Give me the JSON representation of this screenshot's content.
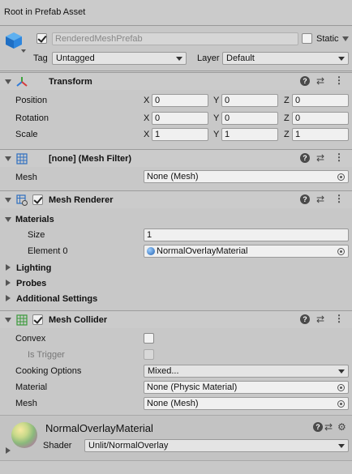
{
  "header": {
    "title": "Root in Prefab Asset"
  },
  "gameobject": {
    "name": "RenderedMeshPrefab",
    "static_label": "Static",
    "tag_label": "Tag",
    "tag_value": "Untagged",
    "layer_label": "Layer",
    "layer_value": "Default"
  },
  "transform": {
    "title": "Transform",
    "rows": [
      {
        "label": "Position",
        "x": "0",
        "y": "0",
        "z": "0"
      },
      {
        "label": "Rotation",
        "x": "0",
        "y": "0",
        "z": "0"
      },
      {
        "label": "Scale",
        "x": "1",
        "y": "1",
        "z": "1"
      }
    ],
    "x": "X",
    "y": "Y",
    "z": "Z"
  },
  "mesh_filter": {
    "title": "[none] (Mesh Filter)",
    "mesh_label": "Mesh",
    "mesh_value": "None (Mesh)"
  },
  "mesh_renderer": {
    "title": "Mesh Renderer",
    "materials_label": "Materials",
    "size_label": "Size",
    "size_value": "1",
    "element0_label": "Element 0",
    "element0_value": "NormalOverlayMaterial",
    "lighting": "Lighting",
    "probes": "Probes",
    "additional": "Additional Settings"
  },
  "mesh_collider": {
    "title": "Mesh Collider",
    "convex_label": "Convex",
    "is_trigger_label": "Is Trigger",
    "cooking_label": "Cooking Options",
    "cooking_value": "Mixed...",
    "material_label": "Material",
    "material_value": "None (Physic Material)",
    "mesh_label": "Mesh",
    "mesh_value": "None (Mesh)"
  },
  "material": {
    "name": "NormalOverlayMaterial",
    "shader_label": "Shader",
    "shader_value": "Unlit/NormalOverlay"
  },
  "icons": {
    "help": "?",
    "preset": "⇄",
    "kebab": "⋮",
    "gear": "⚙"
  }
}
